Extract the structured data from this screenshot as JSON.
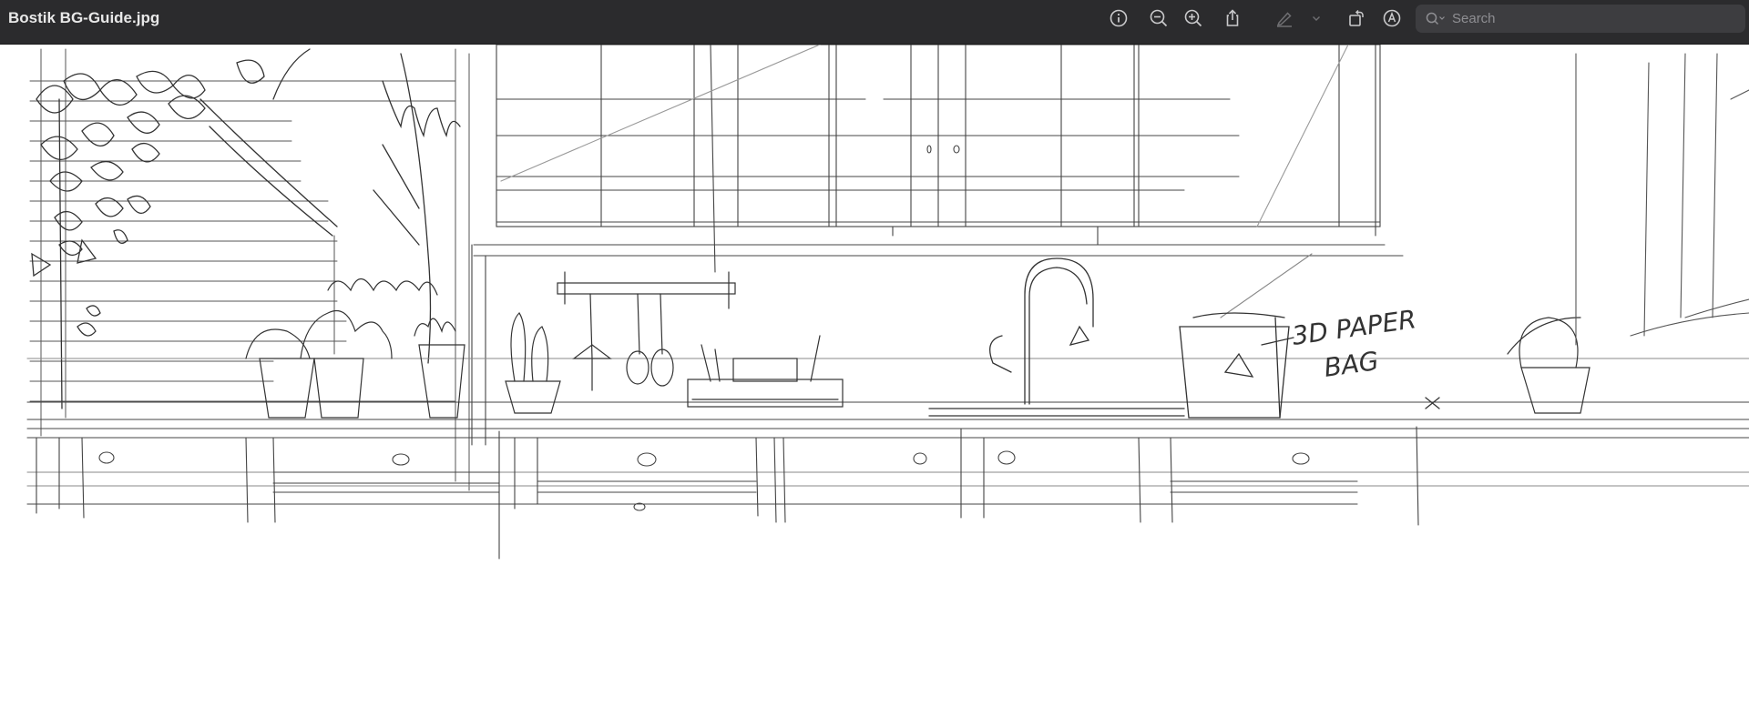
{
  "window": {
    "title": "Bostik BG-Guide.jpg"
  },
  "toolbar": {
    "info_icon": "info-circle-icon",
    "zoom_out_icon": "zoom-out-icon",
    "zoom_in_icon": "zoom-in-icon",
    "share_icon": "share-icon",
    "highlight_icon": "highlighter-pen-icon",
    "highlight_menu_icon": "chevron-down-icon",
    "rotate_icon": "rotate-icon",
    "markup_icon": "markup-circle-icon"
  },
  "search": {
    "placeholder": "Search",
    "value": ""
  },
  "image": {
    "sketch_annotation_line1": "3D PAPER",
    "sketch_annotation_line2": "BAG"
  }
}
